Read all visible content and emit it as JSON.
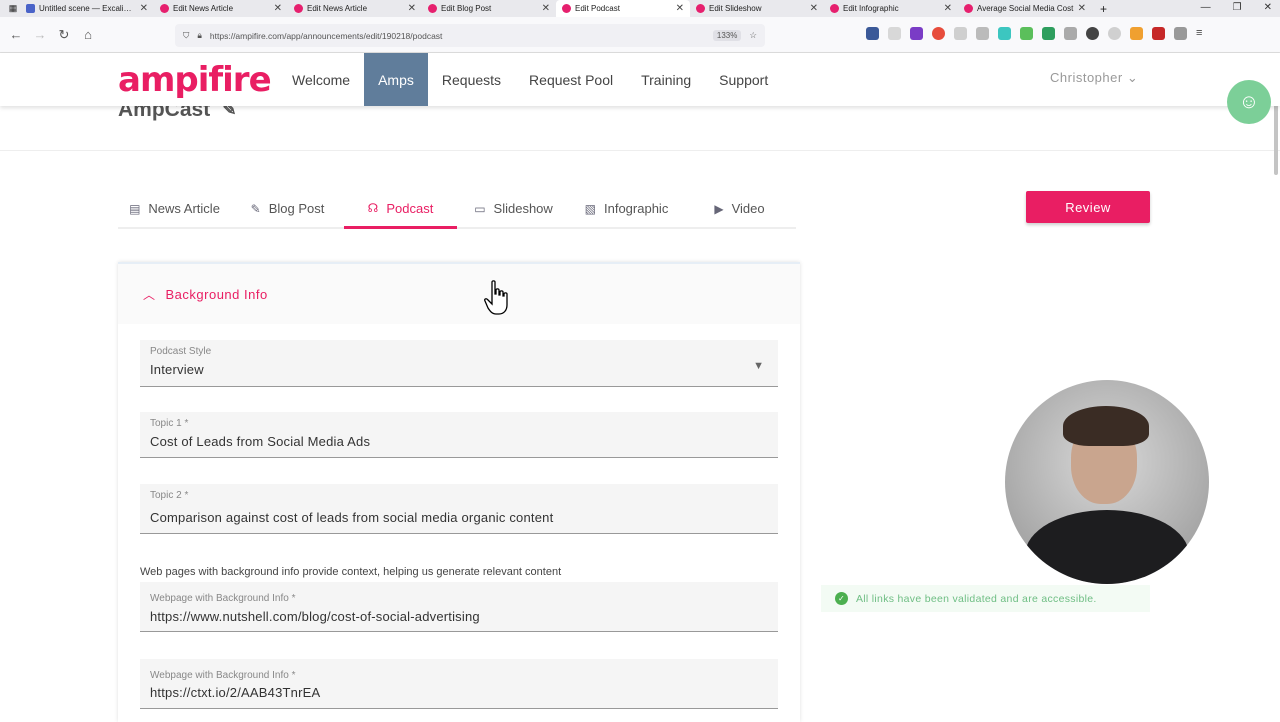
{
  "browser": {
    "tabs": [
      {
        "title": "Untitled scene — Excalidraw",
        "active": false
      },
      {
        "title": "Edit News Article",
        "active": false
      },
      {
        "title": "Edit News Article",
        "active": false
      },
      {
        "title": "Edit Blog Post",
        "active": false
      },
      {
        "title": "Edit Podcast",
        "active": true
      },
      {
        "title": "Edit Slideshow",
        "active": false
      },
      {
        "title": "Edit Infographic",
        "active": false
      },
      {
        "title": "Average Social Media Cost",
        "active": false
      }
    ],
    "url": "https://ampifire.com/app/announcements/edit/190218/podcast",
    "zoom": "133%"
  },
  "header": {
    "logo": "ampifire",
    "menu": [
      "Welcome",
      "Amps",
      "Requests",
      "Request Pool",
      "Training",
      "Support"
    ],
    "active_menu": "Amps",
    "user": "Christopher"
  },
  "page": {
    "title": "AmpCast"
  },
  "amp_tabs": [
    {
      "label": "News Article",
      "icon": "document-icon"
    },
    {
      "label": "Blog Post",
      "icon": "edit-square-icon"
    },
    {
      "label": "Podcast",
      "icon": "headphones-icon"
    },
    {
      "label": "Slideshow",
      "icon": "monitor-icon"
    },
    {
      "label": "Infographic",
      "icon": "file-image-icon"
    },
    {
      "label": "Video",
      "icon": "play-circle-icon"
    }
  ],
  "active_amp_tab": "Podcast",
  "review_label": "Review",
  "panel": {
    "heading": "Background Info",
    "podcast_style": {
      "label": "Podcast Style",
      "value": "Interview"
    },
    "topic1": {
      "label": "Topic 1 *",
      "value": "Cost of Leads from Social Media Ads"
    },
    "topic2": {
      "label": "Topic 2 *",
      "value": "Comparison against cost of leads from social media organic content"
    },
    "helper": "Web pages with background info provide context, helping us generate relevant content",
    "webpage1": {
      "label": "Webpage with Background Info *",
      "value": "https://www.nutshell.com/blog/cost-of-social-advertising"
    },
    "webpage2": {
      "label": "Webpage with Background Info *",
      "value": "https://ctxt.io/2/AAB43TnrEA"
    }
  },
  "toast": "All links have been validated and are accessible.",
  "colors": {
    "brand": "#e91e63",
    "active_menu": "#607d9b",
    "success": "#4caf50"
  }
}
